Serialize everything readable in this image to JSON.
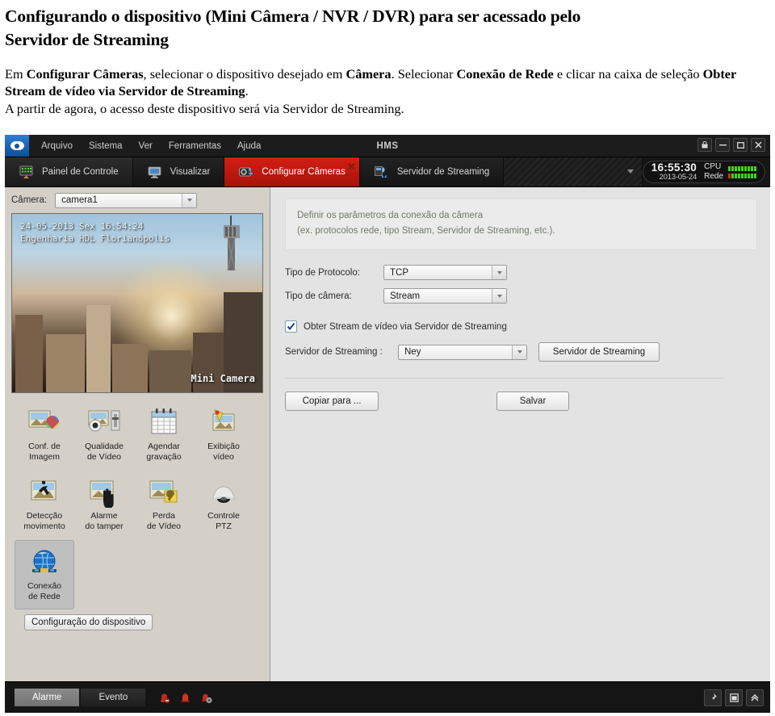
{
  "document": {
    "title_line1": "Configurando o dispositivo (Mini Câmera / NVR / DVR) para ser acessado pelo",
    "title_line2": "Servidor de Streaming",
    "para1_a": "Em ",
    "para1_b": "Configurar Câmeras",
    "para1_c": ", selecionar o dispositivo desejado em ",
    "para1_d": "Câmera",
    "para1_e": ". Selecionar ",
    "para1_f": "Conexão de Rede",
    "para1_g": " e clicar na caixa de seleção ",
    "para1_h": "Obter Stream de vídeo via Servidor de Streaming",
    "para1_i": ".",
    "para2": "A partir de agora, o acesso deste dispositivo será via Servidor de Streaming."
  },
  "app": {
    "title": "HMS",
    "menu": [
      {
        "label": "Arquivo"
      },
      {
        "label": "Sistema"
      },
      {
        "label": "Ver"
      },
      {
        "label": "Ferramentas"
      },
      {
        "label": "Ajuda"
      }
    ],
    "window_controls": [
      {
        "name": "lock-icon",
        "glyph": "⌂"
      },
      {
        "name": "minimize-icon",
        "glyph": "–"
      },
      {
        "name": "maximize-icon",
        "glyph": "□"
      },
      {
        "name": "close-icon",
        "glyph": "✕"
      }
    ],
    "tabs": [
      {
        "label": "Painel de Controle",
        "icon": "control-panel-icon",
        "active": false
      },
      {
        "label": "Visualizar",
        "icon": "monitor-icon",
        "active": false
      },
      {
        "label": "Configurar Câmeras",
        "icon": "camera-config-icon",
        "active": true,
        "close": "✕"
      },
      {
        "label": "Servidor de Streaming",
        "icon": "streaming-server-icon",
        "active": false
      }
    ],
    "status": {
      "time": "16:55:30",
      "date": "2013-05-24",
      "cpu_label": "CPU",
      "net_label": "Rede",
      "cpu_segments": 9,
      "net_segments": 9,
      "net_red_segments": 1,
      "cpu_color": "#3bd617",
      "net_alert_color": "#e02a12"
    }
  },
  "left_pane": {
    "camera_label": "Câmera:",
    "camera_value": "camera1",
    "video_overlay": {
      "timestamp": "24-05-2013 Sex 16:54:24",
      "location": "Engenharia HDL Florianópolis",
      "camera_name": "Mini Camera"
    },
    "icons": [
      {
        "icon": "image-settings-icon",
        "line1": "Conf. de",
        "line2": "Imagem",
        "selected": false
      },
      {
        "icon": "video-quality-icon",
        "line1": "Qualidade",
        "line2": "de Vídeo",
        "selected": false
      },
      {
        "icon": "recording-schedule-icon",
        "line1": "Agendar",
        "line2": "gravação",
        "selected": false
      },
      {
        "icon": "video-display-icon",
        "line1": "Exibição",
        "line2": "vídeo",
        "selected": false
      },
      {
        "icon": "motion-detection-icon",
        "line1": "Detecção",
        "line2": "movimento",
        "selected": false
      },
      {
        "icon": "tamper-alarm-icon",
        "line1": "Alarme",
        "line2": "do tamper",
        "selected": false
      },
      {
        "icon": "video-loss-icon",
        "line1": "Perda",
        "line2": "de Vídeo",
        "selected": false
      },
      {
        "icon": "ptz-control-icon",
        "line1": "Controle",
        "line2": "PTZ",
        "selected": false
      },
      {
        "icon": "network-connection-icon",
        "line1": "Conexão",
        "line2": "de Rede",
        "selected": true
      }
    ],
    "device_config_button": "Configuração do dispositivo"
  },
  "right_pane": {
    "hint_line1": "Definir os parâmetros da conexão da câmera",
    "hint_line2": "(ex. protocolos rede, tipo Stream, Servidor de Streaming, etc.).",
    "protocol_label": "Tipo de Protocolo:",
    "protocol_value": "TCP",
    "camera_type_label": "Tipo de câmera:",
    "camera_type_value": "Stream",
    "checkbox_label": "Obter Stream de vídeo via Servidor de Streaming",
    "checkbox_checked": true,
    "streaming_label": "Servidor de Streaming :",
    "streaming_value": "Ney",
    "streaming_button": "Servidor de Streaming",
    "copy_button": "Copiar para ...",
    "save_button": "Salvar"
  },
  "bottom_bar": {
    "tabs": [
      {
        "label": "Alarme",
        "active": true
      },
      {
        "label": "Evento",
        "active": false
      }
    ],
    "icons": [
      {
        "name": "alarm-mute-icon"
      },
      {
        "name": "alarm-bell-icon"
      },
      {
        "name": "alarm-settings-icon"
      }
    ],
    "right_controls": [
      {
        "name": "pin-icon"
      },
      {
        "name": "window-icon"
      },
      {
        "name": "collapse-up-icon"
      }
    ]
  }
}
